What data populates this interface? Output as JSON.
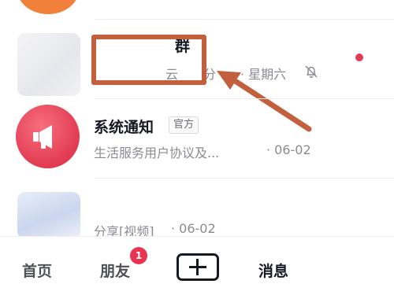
{
  "colors": {
    "accent": "#e23a55",
    "annotation": "#c2603d",
    "text_primary": "#161823",
    "text_secondary": "#8a8b91"
  },
  "conversations": [
    {
      "title": "群",
      "preview": "云",
      "preview_suffix": "分",
      "time": "· 星期六",
      "muted_icon": "bell-off-icon",
      "unread": true
    },
    {
      "title": "系统通知",
      "badge": "官方",
      "preview": "生活服务用户协议及...",
      "time": "· 06-02",
      "avatar_icon": "megaphone-icon"
    },
    {
      "preview": "分享[视频]",
      "time": "· 06-02"
    }
  ],
  "tab_bar": {
    "home": "首页",
    "friends": "朋友",
    "friends_badge": "1",
    "create_icon": "plus-icon",
    "messages": "消息"
  },
  "annotation": {
    "shape": "highlight-rectangle",
    "pointer": "arrow-icon"
  }
}
